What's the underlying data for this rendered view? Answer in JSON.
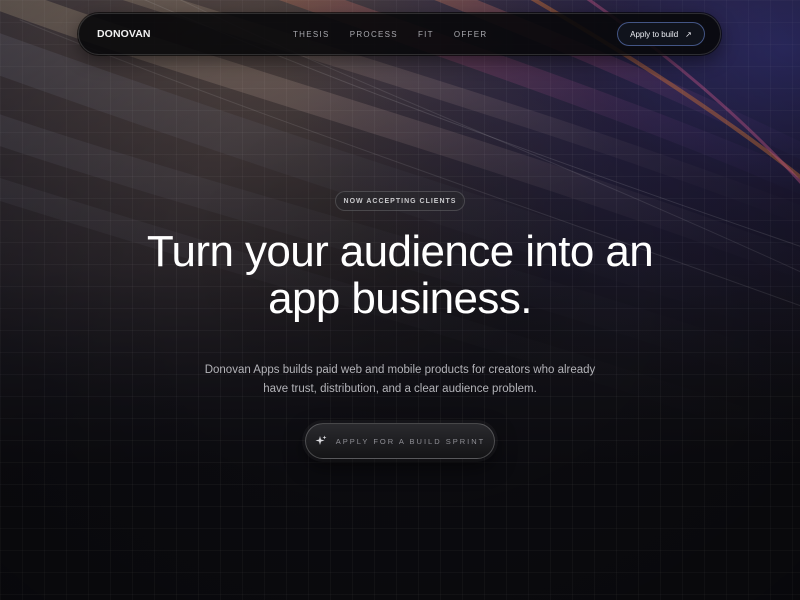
{
  "nav": {
    "brand": "DONOVAN",
    "links": [
      "THESIS",
      "PROCESS",
      "FIT",
      "OFFER"
    ],
    "cta_label": "Apply to build",
    "cta_icon": "arrow-up-right-icon"
  },
  "hero": {
    "badge": "NOW ACCEPTING CLIENTS",
    "headline_line1": "Turn your audience into an",
    "headline_line2": "app business.",
    "subtitle_line1": "Donovan Apps builds paid web and mobile products for creators who already",
    "subtitle_line2": "have trust, distribution, and a clear audience problem.",
    "cta_label": "APPLY FOR A BUILD SPRINT",
    "cta_icon": "sparkle-icon"
  },
  "colors": {
    "background": "#0b0b10",
    "nav_cta_border": "#6e8cdc",
    "text_primary": "#ffffff",
    "text_muted": "#b3b3b8"
  }
}
